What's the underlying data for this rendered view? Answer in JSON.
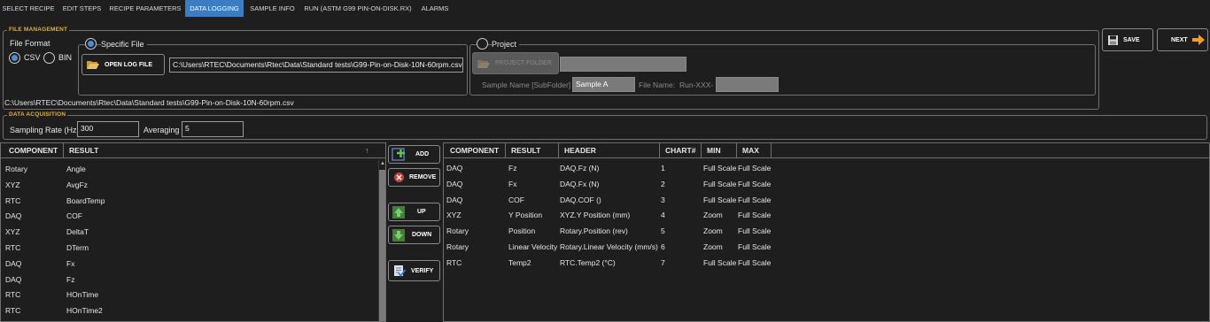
{
  "tabs": [
    {
      "label": "SELECT RECIPE",
      "active": false
    },
    {
      "label": "EDIT STEPS",
      "active": false
    },
    {
      "label": "RECIPE PARAMETERS",
      "active": false
    },
    {
      "label": "DATA LOGGING",
      "active": true
    },
    {
      "label": "SAMPLE INFO",
      "active": false
    },
    {
      "label": "RUN (ASTM G99 PIN-ON-DISK.RX)",
      "active": false
    },
    {
      "label": "ALARMS",
      "active": false
    }
  ],
  "file_management": {
    "title": "FILE MANAGEMENT",
    "file_format_label": "File Format",
    "csv_label": "CSV",
    "bin_label": "BIN",
    "format_selected": "CSV",
    "specific_file_label": "Specific File",
    "open_log_file_label": "OPEN LOG FILE",
    "file_path": "C:\\Users\\RTEC\\Documents\\Rtec\\Data\\Standard tests\\G99-Pin-on-Disk-10N-60rpm.csv",
    "project_label": "Project",
    "project_folder_label": "PROJECT FOLDER",
    "project_folder_value": "",
    "sample_name_label": "Sample Name [SubFolder]",
    "sample_name_value": "Sample A",
    "file_name_label": "File Name:",
    "file_name_prefix": "Run-XXX-",
    "file_name_value": "",
    "footer_path": "C:\\Users\\RTEC\\Documents\\Rtec\\Data\\Standard tests\\G99-Pin-on-Disk-10N-60rpm.csv"
  },
  "actions": {
    "save_label": "SAVE",
    "next_label": "NEXT"
  },
  "data_acquisition": {
    "title": "DATA ACQUISITION",
    "sampling_rate_label": "Sampling Rate (Hz)",
    "sampling_rate_value": "300",
    "averaging_label": "Averaging",
    "averaging_value": "5"
  },
  "available": {
    "headers": [
      "COMPONENT",
      "RESULT"
    ],
    "rows": [
      [
        "Rotary",
        "Angle"
      ],
      [
        "XYZ",
        "AvgFz"
      ],
      [
        "RTC",
        "BoardTemp"
      ],
      [
        "DAQ",
        "COF"
      ],
      [
        "XYZ",
        "DeltaT"
      ],
      [
        "RTC",
        "DTerm"
      ],
      [
        "DAQ",
        "Fx"
      ],
      [
        "DAQ",
        "Fz"
      ],
      [
        "RTC",
        "HOnTime"
      ],
      [
        "RTC",
        "HOnTime2"
      ]
    ],
    "scroll_position": 0.05
  },
  "middle_buttons": {
    "add": "ADD",
    "remove": "REMOVE",
    "up": "UP",
    "down": "DOWN",
    "verify": "VERIFY"
  },
  "selected": {
    "headers": [
      "COMPONENT",
      "RESULT",
      "HEADER",
      "CHART#",
      "MIN",
      "MAX"
    ],
    "rows": [
      [
        "DAQ",
        "Fz",
        "DAQ.Fz (N)",
        "1",
        "Full Scale",
        "Full Scale"
      ],
      [
        "DAQ",
        "Fx",
        "DAQ.Fx (N)",
        "2",
        "Full Scale",
        "Full Scale"
      ],
      [
        "DAQ",
        "COF",
        "DAQ.COF ()",
        "3",
        "Full Scale",
        "Full Scale"
      ],
      [
        "XYZ",
        "Y Position",
        "XYZ.Y Position (mm)",
        "4",
        "Zoom",
        "Full Scale"
      ],
      [
        "Rotary",
        "Position",
        "Rotary.Position (rev)",
        "5",
        "Zoom",
        "Full Scale"
      ],
      [
        "Rotary",
        "Linear Velocity",
        "Rotary.Linear Velocity (mm/s)",
        "6",
        "Zoom",
        "Full Scale"
      ],
      [
        "RTC",
        "Temp2",
        "RTC.Temp2 (°C)",
        "7",
        "Full Scale",
        "Full Scale"
      ]
    ]
  },
  "colors": {
    "background": "#1e1e1e",
    "active_tab": "#3c7cc2",
    "section_title": "#e0b040",
    "next_arrow": "#f0a020",
    "radio_selected": "#4a8fd8"
  }
}
